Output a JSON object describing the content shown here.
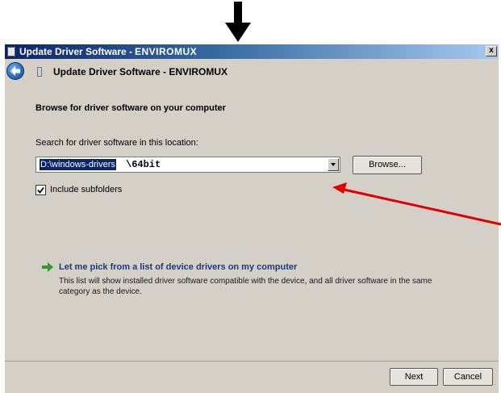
{
  "window": {
    "title": "Update Driver Software -",
    "title_product": "ENVIROMUX",
    "close_glyph": "x"
  },
  "header": {
    "title": "Update Driver Software -  ENVIROMUX"
  },
  "content": {
    "section_heading": "Browse for driver software on your computer",
    "search_label": "Search for driver software in this location:",
    "path_selected": "D:\\windows-drivers",
    "path_rest": "\\64bit",
    "browse_label": "Browse...",
    "include_subfolders_label": "Include subfolders",
    "include_subfolders_checked": true,
    "pick_title": "Let me pick from a list of device drivers on my computer",
    "pick_description": "This list will show installed driver software compatible with the device, and all driver software in the same category as the device."
  },
  "footer": {
    "next_label": "Next",
    "cancel_label": "Cancel"
  },
  "icons": {
    "top_arrow": "down-arrow-icon",
    "back": "back-arrow-icon",
    "pick": "green-arrow-icon",
    "annotation": "red-arrow-icon"
  },
  "colors": {
    "title_gradient_start": "#0a246a",
    "annotation_arrow": "#e00000",
    "pick_arrow": "#2e9a2e",
    "selection": "#0a246a"
  }
}
